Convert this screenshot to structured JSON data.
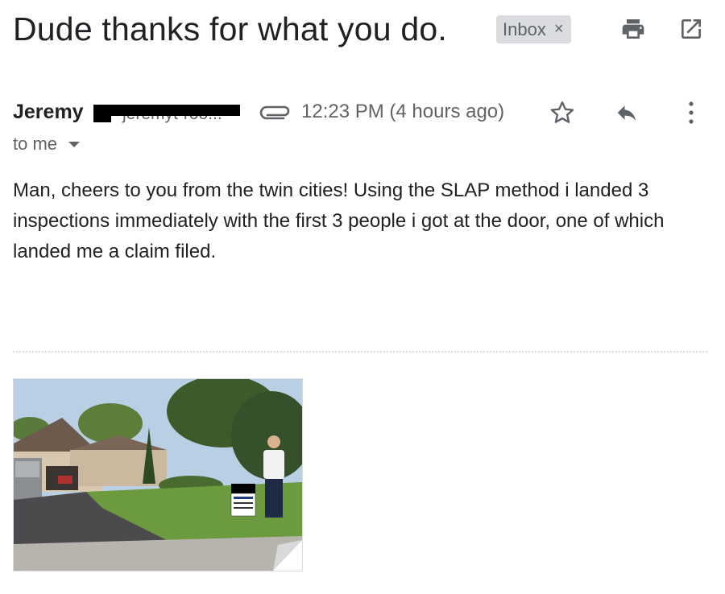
{
  "email": {
    "subject": "Dude thanks for what you do.",
    "label": "Inbox",
    "label_remove": "×",
    "sender_name": "Jeremy",
    "sender_email_partial": "jeremyt-roo...",
    "time": "12:23 PM (4 hours ago)",
    "to": "to me",
    "body": "Man, cheers to you from the twin cities! Using the SLAP method i landed 3 inspections immediately with the first 3 people i got at the door, one of which landed me a claim filed.",
    "attachment": {
      "sign_text": "STORM DAMAGE"
    }
  },
  "icons": {
    "print": "print-icon",
    "open_new": "open-in-new-window-icon",
    "attach": "paperclip-icon",
    "star": "star-icon",
    "reply": "reply-icon",
    "more": "more-vertical-icon",
    "dropdown": "chevron-down-icon"
  },
  "colors": {
    "text_primary": "#202124",
    "text_secondary": "#5f6368",
    "chip_bg": "#dadce0"
  }
}
